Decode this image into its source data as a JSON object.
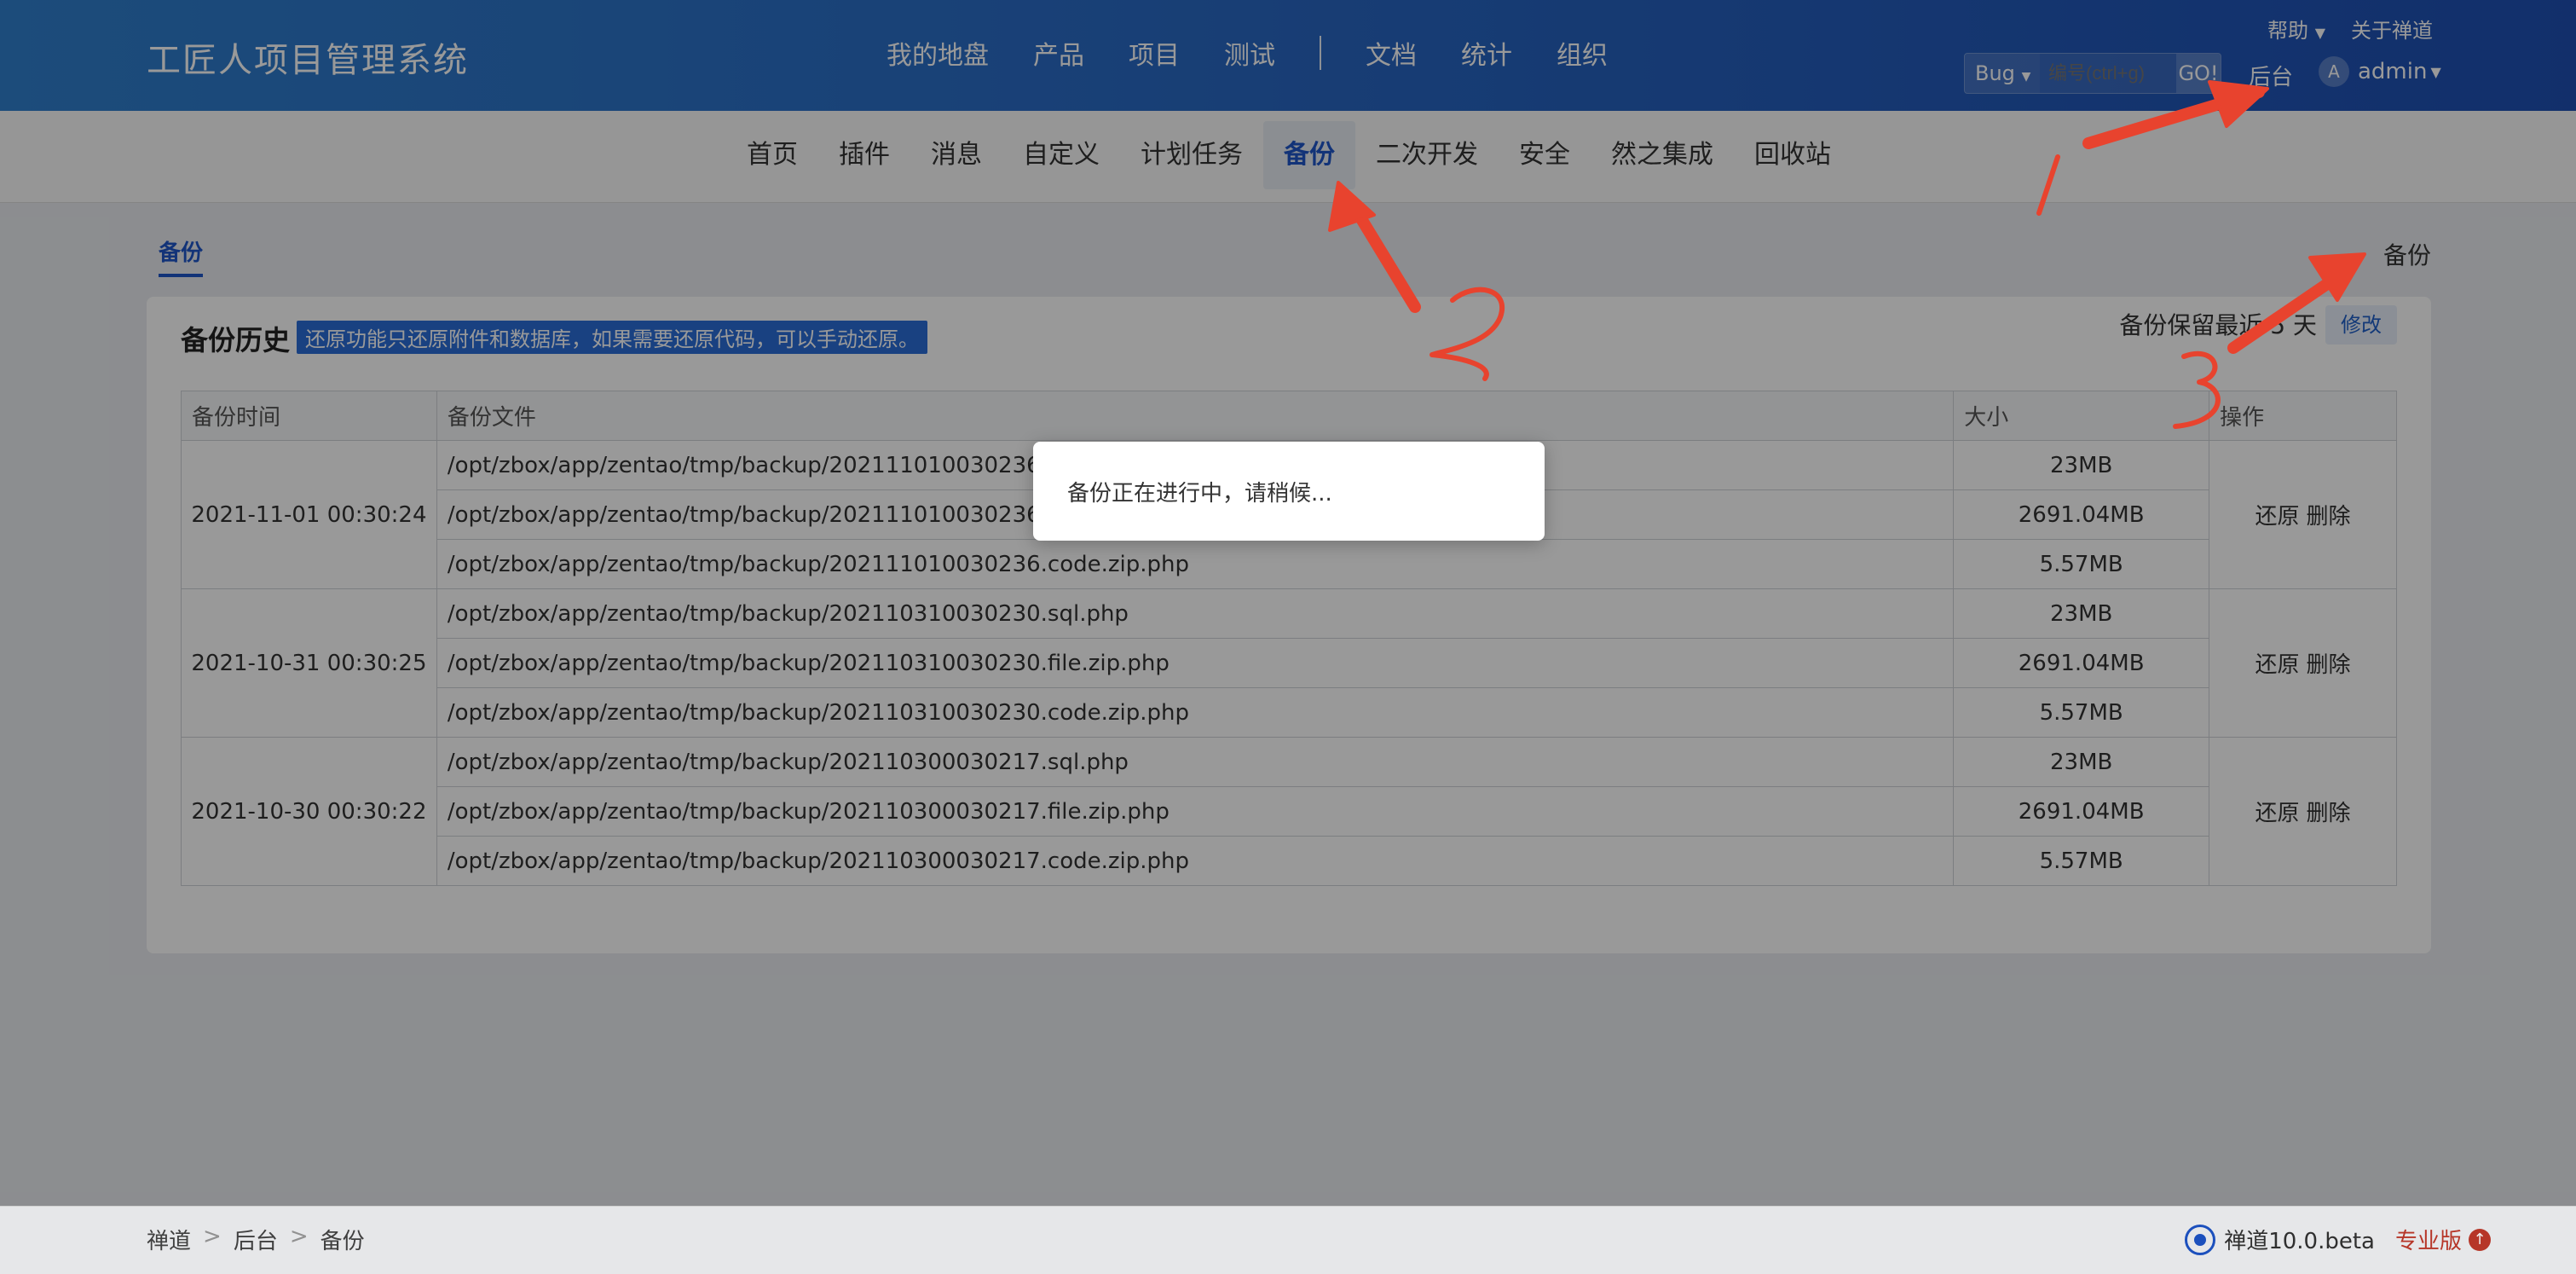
{
  "app": {
    "brand": "工匠人项目管理系统"
  },
  "header": {
    "nav": [
      "我的地盘",
      "产品",
      "项目",
      "测试",
      "文档",
      "统计",
      "组织"
    ],
    "help": "帮助",
    "about": "关于禅道",
    "search": {
      "type": "Bug",
      "placeholder": "编号(ctrl+g)",
      "go": "GO!"
    },
    "backend": "后台",
    "user": {
      "avatar": "A",
      "name": "admin"
    }
  },
  "subnav": {
    "tabs": [
      "首页",
      "插件",
      "消息",
      "自定义",
      "计划任务",
      "备份",
      "二次开发",
      "安全",
      "然之集成",
      "回收站"
    ],
    "active_index": 5
  },
  "page": {
    "tab": "备份",
    "right_label": "备份"
  },
  "panel": {
    "title": "备份历史",
    "note": "还原功能只还原附件和数据库，如果需要还原代码，可以手动还原。",
    "keep": "备份保留最近 5 天",
    "edit": "修改",
    "columns": [
      "备份时间",
      "备份文件",
      "大小",
      "操作"
    ],
    "op_restore": "还原",
    "op_delete": "删除",
    "groups": [
      {
        "time": "2021-11-01 00:30:24",
        "files": [
          {
            "path": "/opt/zbox/app/zentao/tmp/backup/202111010030236.sql.php",
            "size": "23MB"
          },
          {
            "path": "/opt/zbox/app/zentao/tmp/backup/202111010030236.file.zip.php",
            "size": "2691.04MB"
          },
          {
            "path": "/opt/zbox/app/zentao/tmp/backup/202111010030236.code.zip.php",
            "size": "5.57MB"
          }
        ]
      },
      {
        "time": "2021-10-31 00:30:25",
        "files": [
          {
            "path": "/opt/zbox/app/zentao/tmp/backup/202110310030230.sql.php",
            "size": "23MB"
          },
          {
            "path": "/opt/zbox/app/zentao/tmp/backup/202110310030230.file.zip.php",
            "size": "2691.04MB"
          },
          {
            "path": "/opt/zbox/app/zentao/tmp/backup/202110310030230.code.zip.php",
            "size": "5.57MB"
          }
        ]
      },
      {
        "time": "2021-10-30 00:30:22",
        "files": [
          {
            "path": "/opt/zbox/app/zentao/tmp/backup/202110300030217.sql.php",
            "size": "23MB"
          },
          {
            "path": "/opt/zbox/app/zentao/tmp/backup/202110300030217.file.zip.php",
            "size": "2691.04MB"
          },
          {
            "path": "/opt/zbox/app/zentao/tmp/backup/202110300030217.code.zip.php",
            "size": "5.57MB"
          }
        ]
      }
    ]
  },
  "dialog": {
    "message": "备份正在进行中，请稍候..."
  },
  "footer": {
    "breadcrumb": [
      "禅道",
      "后台",
      "备份"
    ],
    "version": "禅道10.0.beta",
    "edition": "专业版"
  },
  "annotations": {
    "labels": [
      "1",
      "2",
      "3"
    ],
    "color": "#e8432e"
  }
}
